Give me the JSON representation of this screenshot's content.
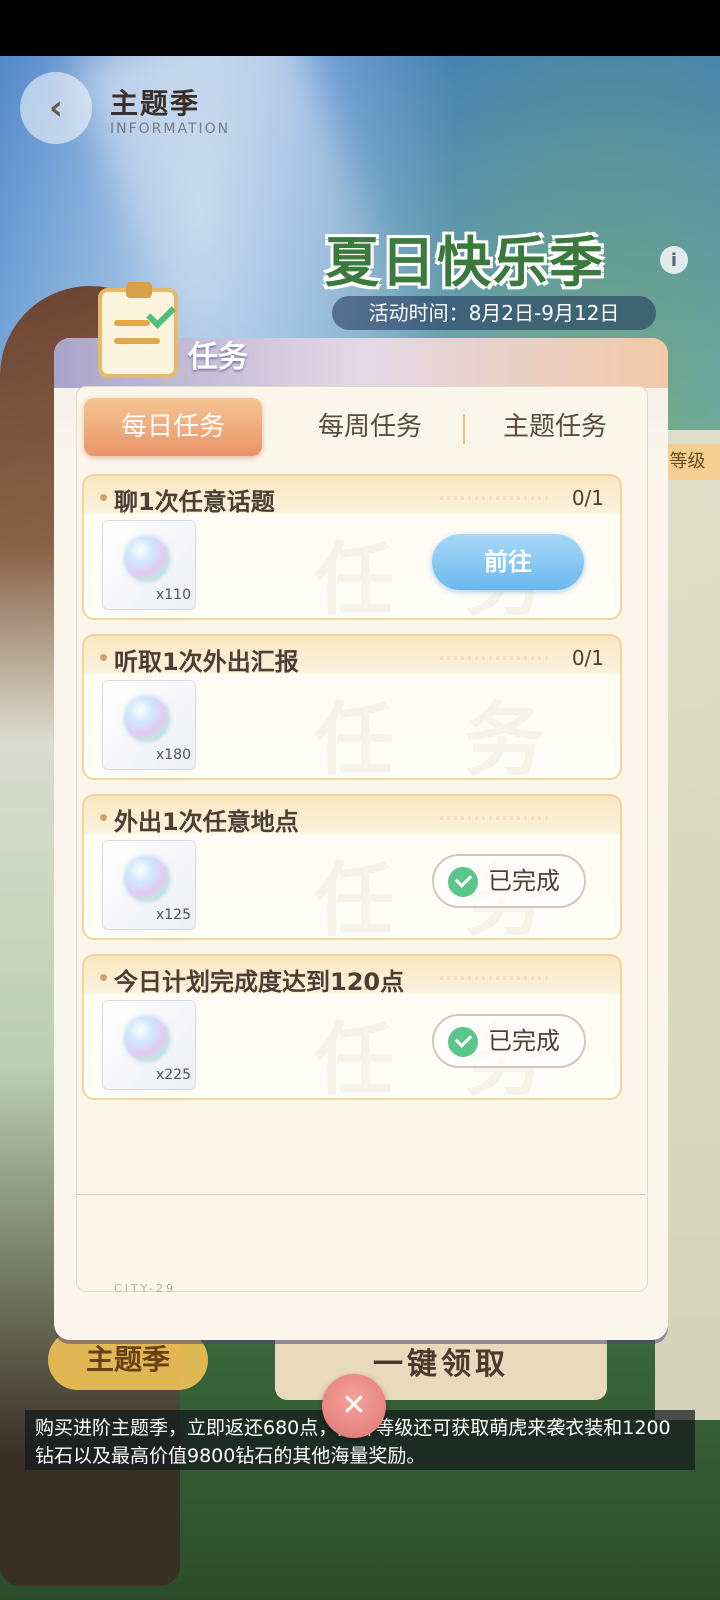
{
  "header": {
    "title": "主题季",
    "subtitle": "INFORMATION"
  },
  "event": {
    "title": "夏日快乐季",
    "time": "活动时间：8月2日-9月12日"
  },
  "background": {
    "level_tag": "等级",
    "claim_all": "一键领取",
    "left_fragment": "主题季",
    "description": "购买进阶主题季，立即返还680点，提升等级还可获取萌虎来袭衣装和1200钻石以及最高价值9800钻石的其他海量奖励。"
  },
  "dialog": {
    "title": "任务",
    "tabs": [
      {
        "label": "每日任务",
        "active": true
      },
      {
        "label": "每周任务",
        "active": false
      },
      {
        "label": "主题任务",
        "active": false
      }
    ],
    "tasks": [
      {
        "title": "聊1次任意话题",
        "progress": "0/1",
        "reward_qty": "x110",
        "status": "go",
        "button": "前往"
      },
      {
        "title": "听取1次外出汇报",
        "progress": "0/1",
        "reward_qty": "x180",
        "status": "pending",
        "button": ""
      },
      {
        "title": "外出1次任意地点",
        "progress": "",
        "reward_qty": "x125",
        "status": "done",
        "button": "已完成"
      },
      {
        "title": "今日计划完成度达到120点",
        "progress": "",
        "reward_qty": "x225",
        "status": "done",
        "button": "已完成"
      }
    ],
    "watermark": "任务",
    "footer_tag": "CITY-29"
  },
  "icons": {
    "back": "back-arrow-icon",
    "close": "close-icon",
    "info": "info-icon",
    "gem": "crystal-orb-icon",
    "check": "check-icon",
    "clipboard": "clipboard-icon"
  },
  "colors": {
    "accent_tab": "#e9936a",
    "go_button": "#6bb7ee",
    "done_check": "#5cc48d"
  }
}
